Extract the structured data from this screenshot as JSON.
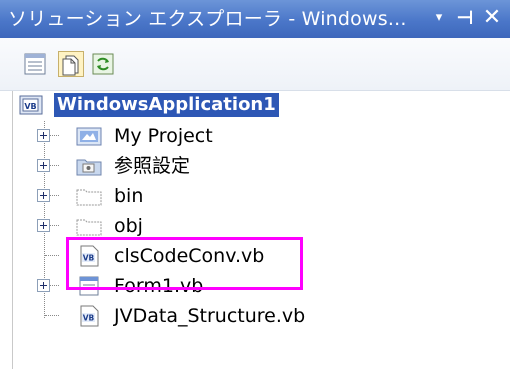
{
  "window": {
    "title": "ソリューション エクスプローラ - Windows...",
    "dropdown_glyph": "▾",
    "pin_glyph": "⊣",
    "close_glyph": "✕"
  },
  "toolbar": {
    "buttons": [
      "properties",
      "show-all-files",
      "refresh"
    ]
  },
  "tree": {
    "root": {
      "label": "WindowsApplication1",
      "icon": "vb-project-icon"
    },
    "items": [
      {
        "label": "My Project",
        "icon": "my-project-icon",
        "expandable": true
      },
      {
        "label": "参照設定",
        "icon": "references-icon",
        "expandable": true
      },
      {
        "label": "bin",
        "icon": "folder-icon",
        "expandable": true
      },
      {
        "label": "obj",
        "icon": "folder-icon",
        "expandable": true
      },
      {
        "label": "clsCodeConv.vb",
        "icon": "vb-file-icon",
        "expandable": false
      },
      {
        "label": "Form1.vb",
        "icon": "form-icon",
        "expandable": true
      },
      {
        "label": "JVData_Structure.vb",
        "icon": "vb-file-icon",
        "expandable": false
      }
    ]
  },
  "annotation": {
    "color": "#ff00ff"
  }
}
